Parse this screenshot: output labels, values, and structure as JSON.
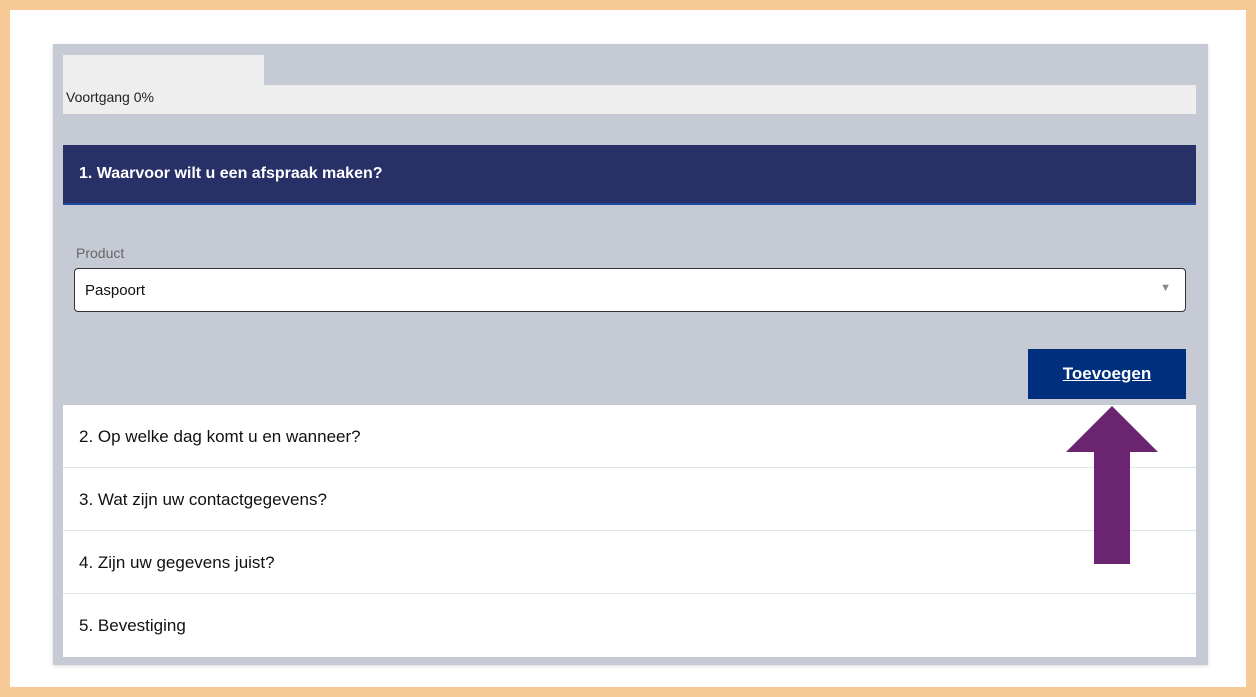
{
  "progress": {
    "label": "Voortgang 0%",
    "value": 0
  },
  "active_step": {
    "title": "1. Waarvoor wilt u een afspraak maken?",
    "field": {
      "label": "Product",
      "selected": "Paspoort"
    },
    "add_button_label": "Toevoegen"
  },
  "steps": [
    {
      "label": "2. Op welke dag komt u en wanneer?"
    },
    {
      "label": "3. Wat zijn uw contactgegevens?"
    },
    {
      "label": "4. Zijn uw gegevens juist?"
    },
    {
      "label": "5. Bevestiging"
    }
  ],
  "icons": {
    "select_caret": "chevron-down-icon",
    "annotation": "up-arrow-icon"
  },
  "colors": {
    "frame": "#f6c996",
    "panel": "#c5cad4",
    "active_header": "#283068",
    "button": "#00307d",
    "arrow": "#6b2470"
  }
}
